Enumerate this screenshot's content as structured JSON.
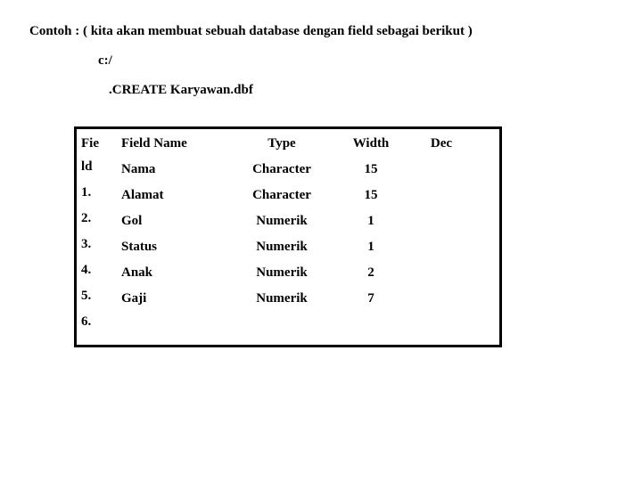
{
  "slide": {
    "background_color": "#ffffff",
    "text_color": "#000000",
    "intro": {
      "title": "Contoh : ( kita akan membuat sebuah database dengan field sebagai berikut )",
      "path_line": "c:/",
      "command_line": ".CREATE Karyawan.dbf"
    },
    "table": {
      "border_color": "#000000",
      "headers": {
        "no": "Fie",
        "field_name": "Field Name",
        "type": "Type",
        "width": "Width",
        "dec": "Dec"
      },
      "index_labels": [
        "ld",
        "1.",
        "2.",
        "3.",
        "4.",
        "5.",
        "6."
      ],
      "rows": [
        {
          "field_name": "Nama",
          "type": "Character",
          "width": "15",
          "dec": ""
        },
        {
          "field_name": "Alamat",
          "type": "Character",
          "width": "15",
          "dec": ""
        },
        {
          "field_name": "Gol",
          "type": "Numerik",
          "width": "1",
          "dec": ""
        },
        {
          "field_name": "Status",
          "type": "Numerik",
          "width": "1",
          "dec": ""
        },
        {
          "field_name": "Anak",
          "type": "Numerik",
          "width": "2",
          "dec": ""
        },
        {
          "field_name": "Gaji",
          "type": "Numerik",
          "width": "7",
          "dec": ""
        }
      ]
    }
  }
}
